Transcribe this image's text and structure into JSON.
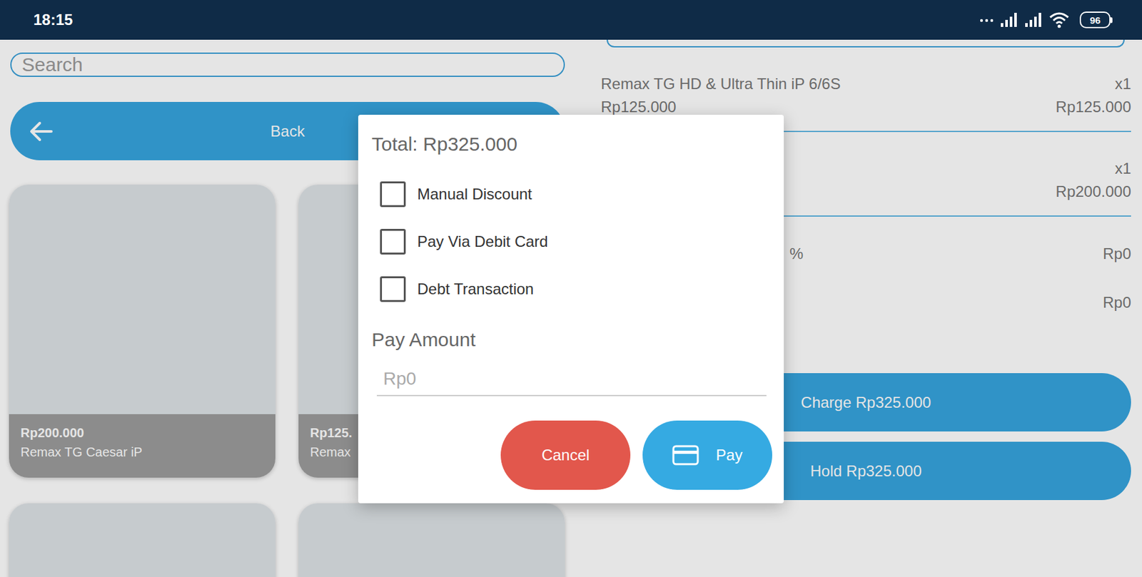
{
  "status_bar": {
    "time": "18:15",
    "battery": "96"
  },
  "search": {
    "placeholder": "Search"
  },
  "back_button": {
    "label": "Back"
  },
  "products": [
    {
      "price": "Rp200.000",
      "name": "Remax TG Caesar iP"
    },
    {
      "price": "Rp125.",
      "name": "Remax"
    },
    {},
    {}
  ],
  "cart": {
    "items": [
      {
        "name": "Remax TG HD & Ultra Thin iP 6/6S",
        "quantity": "x1",
        "price": "Rp125.000",
        "subtotal": "Rp125.000"
      },
      {
        "quantity": "x1",
        "subtotal": "Rp200.000"
      }
    ],
    "summary": [
      {
        "label": "%",
        "value": "Rp0"
      },
      {
        "value": "Rp0"
      }
    ],
    "actions": [
      "Charge Rp325.000",
      "Hold Rp325.000"
    ]
  },
  "dialog": {
    "total": "Total: Rp325.000",
    "options": [
      {
        "label": "Manual Discount",
        "checked": false
      },
      {
        "label": "Pay Via Debit Card",
        "checked": false
      },
      {
        "label": "Debt Transaction",
        "checked": false
      }
    ],
    "amount_label": "Pay Amount",
    "amount_placeholder": "Rp0",
    "buttons": [
      {
        "label": "Cancel",
        "kind": "cancel"
      },
      {
        "label": "Pay",
        "kind": "pay"
      }
    ]
  }
}
